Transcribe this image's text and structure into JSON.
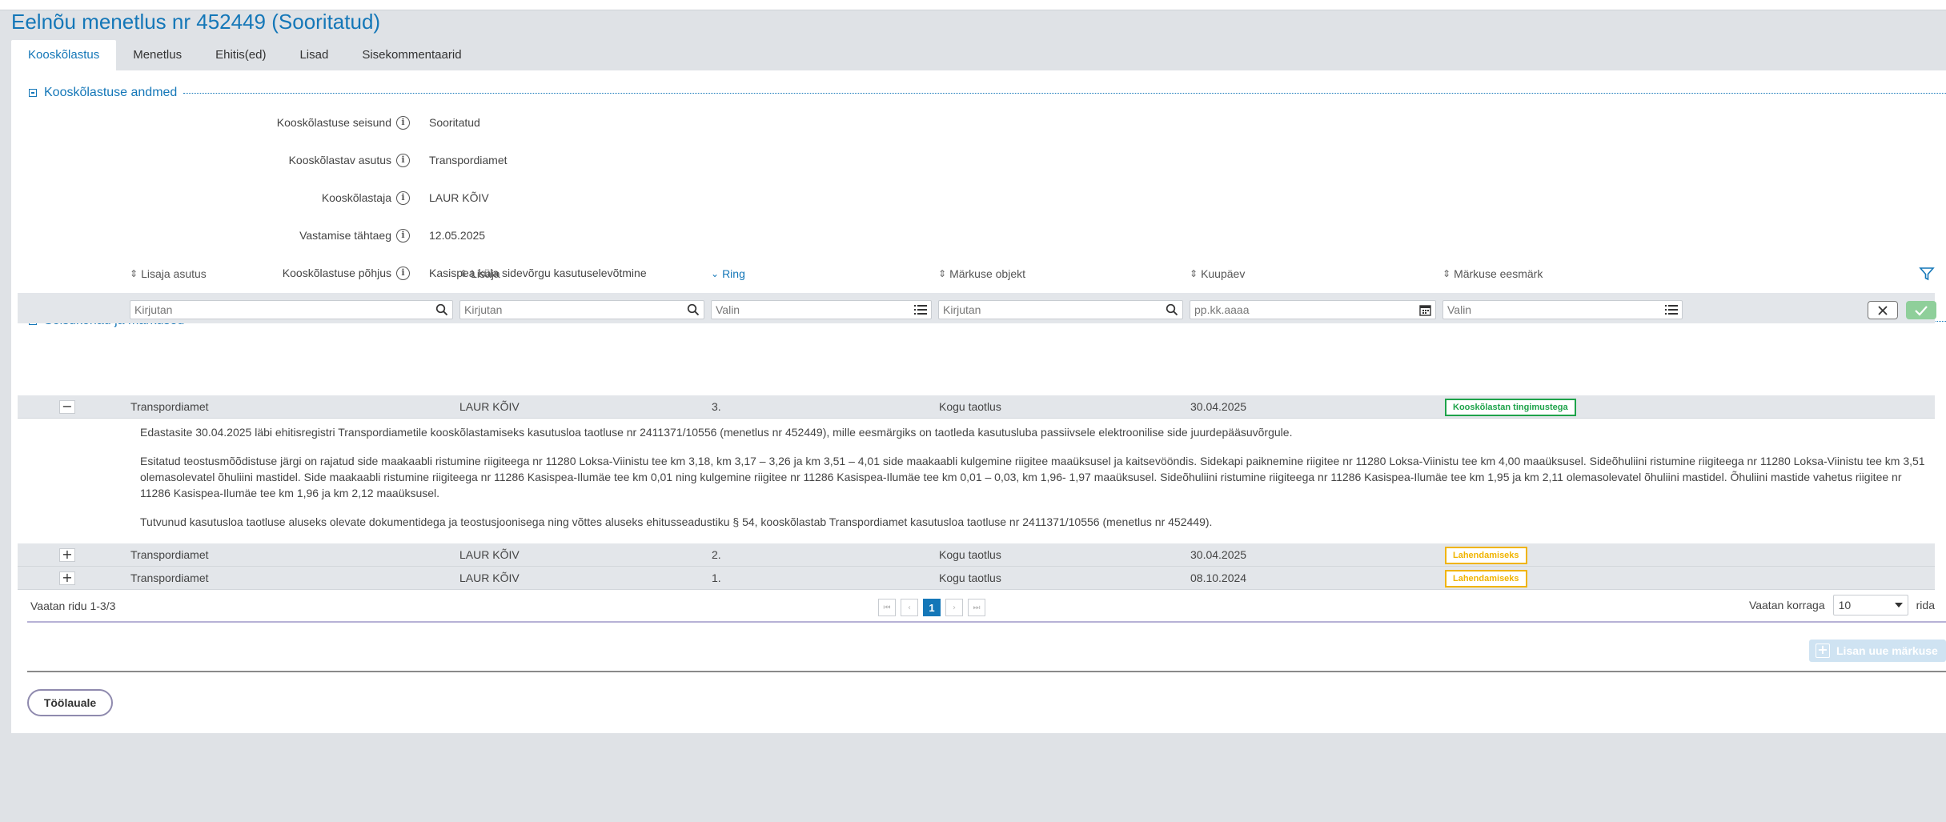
{
  "page": {
    "title": "Eelnõu menetlus nr 452449 (Sooritatud)"
  },
  "tabs": [
    {
      "label": "Kooskõlastus",
      "active": true
    },
    {
      "label": "Menetlus"
    },
    {
      "label": "Ehitis(ed)"
    },
    {
      "label": "Lisad"
    },
    {
      "label": "Sisekommentaarid"
    }
  ],
  "details": {
    "title": "Kooskõlastuse andmed",
    "fields": [
      {
        "label": "Kooskõlastuse seisund",
        "value": "Sooritatud"
      },
      {
        "label": "Kooskõlastav asutus",
        "value": "Transpordiamet"
      },
      {
        "label": "Kooskõlastaja",
        "value": "LAUR KÕIV"
      },
      {
        "label": "Vastamise tähtaeg",
        "value": "12.05.2025"
      },
      {
        "label": "Kooskõlastuse põhjus",
        "value": "Kasispea küla sidevõrgu kasutuselevõtmine"
      }
    ]
  },
  "remarks": {
    "title": "Seisukohad ja märkused",
    "columns": [
      "Lisaja asutus",
      "Lisaja",
      "Ring",
      "Märkuse objekt",
      "Kuupäev",
      "Märkuse eesmärk"
    ],
    "filters": {
      "lisaja_asutus": "Kirjutan",
      "lisaja": "Kirjutan",
      "ring": "Valin",
      "markuse_objekt": "Kirjutan",
      "kuupaev": "pp.kk.aaaa",
      "eesmark": "Valin"
    },
    "rows": [
      {
        "asutus": "Transpordiamet",
        "lisaja": "LAUR KÕIV",
        "ring": "3.",
        "objekt": "Kogu taotlus",
        "kuupaev": "30.04.2025",
        "eesmark": "Kooskõlastan tingimustega",
        "toggle": "−"
      },
      {
        "asutus": "Transpordiamet",
        "lisaja": "LAUR KÕIV",
        "ring": "2.",
        "objekt": "Kogu taotlus",
        "kuupaev": "30.04.2025",
        "eesmark": "Lahendamiseks",
        "toggle": "+"
      },
      {
        "asutus": "Transpordiamet",
        "lisaja": "LAUR KÕIV",
        "ring": "1.",
        "objekt": "Kogu taotlus",
        "kuupaev": "08.10.2024",
        "eesmark": "Lahendamiseks",
        "toggle": "+"
      }
    ],
    "expanded_text": [
      "Edastasite 30.04.2025 läbi ehitisregistri Transpordiametile kooskõlastamiseks kasutusloa taotluse nr 2411371/10556  (menetlus nr 452449), mille eesmärgiks on taotleda kasutusluba passiivsele elektroonilise side juurdepääsuvõrgule.",
      "Esitatud teostusmõõdistuse järgi on rajatud side maakaabli ristumine riigiteega nr 11280 Loksa-Viinistu tee km 3,18, km 3,17 – 3,26 ja km 3,51 – 4,01 side maakaabli kulgemine riigitee maaüksusel ja kaitsevööndis. Sidekapi paiknemine riigitee nr 11280 Loksa-Viinistu tee km 4,00 maaüksusel. Sideõhuliini ristumine riigiteega nr 11280 Loksa-Viinistu tee km 3,51 olemasolevatel õhuliini mastidel. Side maakaabli ristumine riigiteega nr 11286 Kasispea-Ilumäe tee km 0,01 ning kulgemine riigitee nr 11286 Kasispea-Ilumäe tee km 0,01 – 0,03, km 1,96- 1,97 maaüksusel. Sideõhuliini ristumine riigiteega nr 11286 Kasispea-Ilumäe tee km 1,95 ja km 2,11 olemasolevatel õhuliini mastidel. Õhuliini mastide vahetus riigitee nr 11286 Kasispea-Ilumäe tee km 1,96 ja km 2,12 maaüksusel.",
      "Tutvunud kasutusloa taotluse aluseks olevate dokumentidega ja teostusjoonisega ning võttes aluseks ehitusseadustiku § 54, kooskõlastab Transpordiamet kasutusloa taotluse nr 2411371/10556 (menetlus nr 452449)."
    ],
    "footer": {
      "rows_info": "Vaatan ridu 1-3/3",
      "current_page": "1",
      "per_page_label": "Vaatan korraga",
      "per_page_value": "10",
      "per_page_suffix": "rida"
    },
    "add_button": "Lisan uue märkuse"
  },
  "back_button": "Töölauale",
  "colors": {
    "accent": "#1477b8",
    "green": "#1ea34a",
    "yellow": "#f0b400"
  }
}
